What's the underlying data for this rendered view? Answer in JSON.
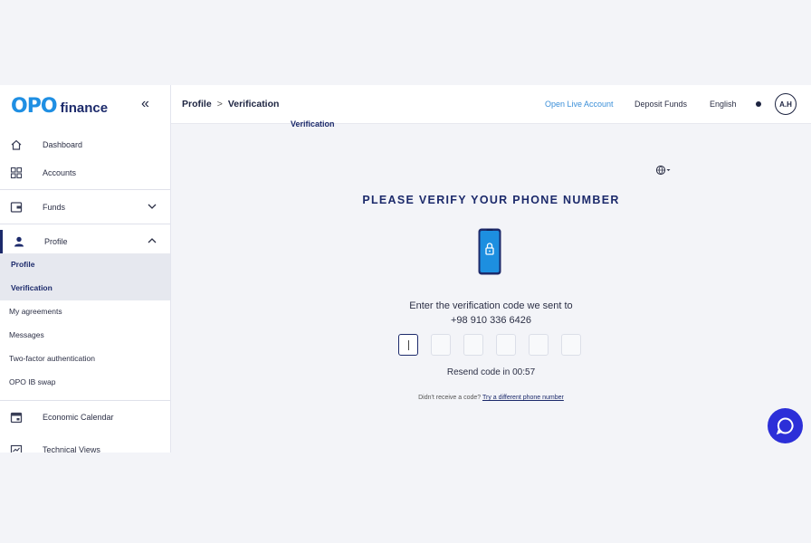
{
  "logo": {
    "mark": "OPO",
    "word": "finance"
  },
  "sidebar": {
    "collapse_icon": "«",
    "items": [
      {
        "label": "Dashboard",
        "icon": "home-icon"
      },
      {
        "label": "Accounts",
        "icon": "grid-icon"
      },
      {
        "label": "Funds",
        "icon": "wallet-icon"
      },
      {
        "label": "Profile",
        "icon": "user-icon"
      },
      {
        "label": "Economic Calendar",
        "icon": "calendar-icon"
      },
      {
        "label": "Technical Views",
        "icon": "chart-icon"
      }
    ],
    "profile_sub": [
      "Profile",
      "Verification",
      "My agreements",
      "Messages",
      "Two-factor authentication",
      "OPO IB swap"
    ]
  },
  "header": {
    "breadcrumb": [
      "Profile",
      "Verification"
    ],
    "open_live": "Open Live Account",
    "deposit": "Deposit Funds",
    "language": "English",
    "avatar": "A.H"
  },
  "main": {
    "cut_title": "Verification",
    "title": "PLEASE VERIFY YOUR PHONE NUMBER",
    "instruction": "Enter the verification code we sent to",
    "phone_number": "+98 910 336 6426",
    "cursor": "|",
    "resend": "Resend code in 00:57",
    "didnt_receive": "Didn't receive a code?",
    "try_different": "Try a different phone number"
  },
  "colors": {
    "brand": "#1c2a6b",
    "accent": "#1f8fe3",
    "chat": "#2c2fd8"
  }
}
